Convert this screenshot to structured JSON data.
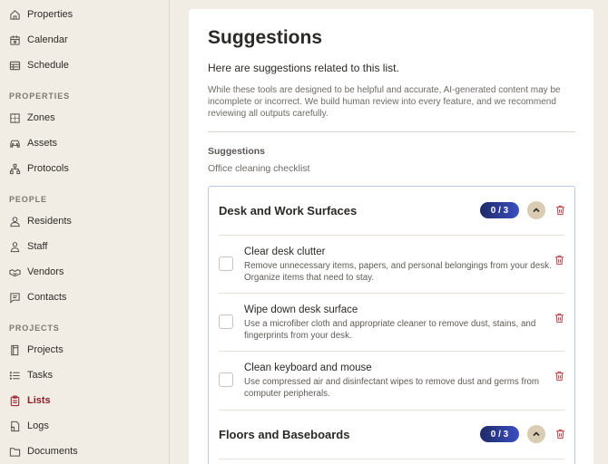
{
  "sidebar": {
    "top_items": [
      {
        "label": "Properties",
        "icon": "home-icon"
      },
      {
        "label": "Calendar",
        "icon": "calendar-icon"
      },
      {
        "label": "Schedule",
        "icon": "schedule-table-icon"
      }
    ],
    "sections": [
      {
        "heading": "PROPERTIES",
        "items": [
          {
            "label": "Zones",
            "icon": "zones-grid-icon"
          },
          {
            "label": "Assets",
            "icon": "car-icon"
          },
          {
            "label": "Protocols",
            "icon": "hierarchy-icon"
          }
        ]
      },
      {
        "heading": "PEOPLE",
        "items": [
          {
            "label": "Residents",
            "icon": "person-icon"
          },
          {
            "label": "Staff",
            "icon": "staff-icon"
          },
          {
            "label": "Vendors",
            "icon": "handshake-icon"
          },
          {
            "label": "Contacts",
            "icon": "contact-card-icon"
          }
        ]
      },
      {
        "heading": "PROJECTS",
        "items": [
          {
            "label": "Projects",
            "icon": "book-icon"
          },
          {
            "label": "Tasks",
            "icon": "task-list-icon"
          },
          {
            "label": "Lists",
            "icon": "clipboard-icon",
            "active": true
          },
          {
            "label": "Logs",
            "icon": "log-note-icon"
          },
          {
            "label": "Documents",
            "icon": "folder-icon"
          }
        ]
      }
    ]
  },
  "main": {
    "title": "Suggestions",
    "subtitle": "Here are suggestions related to this list.",
    "disclaimer": "While these tools are designed to be helpful and accurate, AI-generated content may be incomplete or incorrect. We build human review into every feature, and we recommend reviewing all outputs carefully.",
    "suggestions_label": "Suggestions",
    "suggestions_value": "Office cleaning checklist",
    "groups": [
      {
        "title": "Desk and Work Surfaces",
        "progress": "0 / 3",
        "items": [
          {
            "title": "Clear desk clutter",
            "desc": "Remove unnecessary items, papers, and personal belongings from your desk. Organize items that need to stay."
          },
          {
            "title": "Wipe down desk surface",
            "desc": "Use a microfiber cloth and appropriate cleaner to remove dust, stains, and fingerprints from your desk."
          },
          {
            "title": "Clean keyboard and mouse",
            "desc": "Use compressed air and disinfectant wipes to remove dust and germs from computer peripherals."
          }
        ]
      },
      {
        "title": "Floors and Baseboards",
        "progress": "0 / 3",
        "items": []
      }
    ]
  },
  "colors": {
    "background": "#f1ede4",
    "active_nav": "#8b1f2c",
    "badge_gradient_start": "#1f2a66",
    "badge_gradient_end": "#3a4fc2",
    "trash": "#b8444b",
    "list_border": "#b9cde6"
  }
}
